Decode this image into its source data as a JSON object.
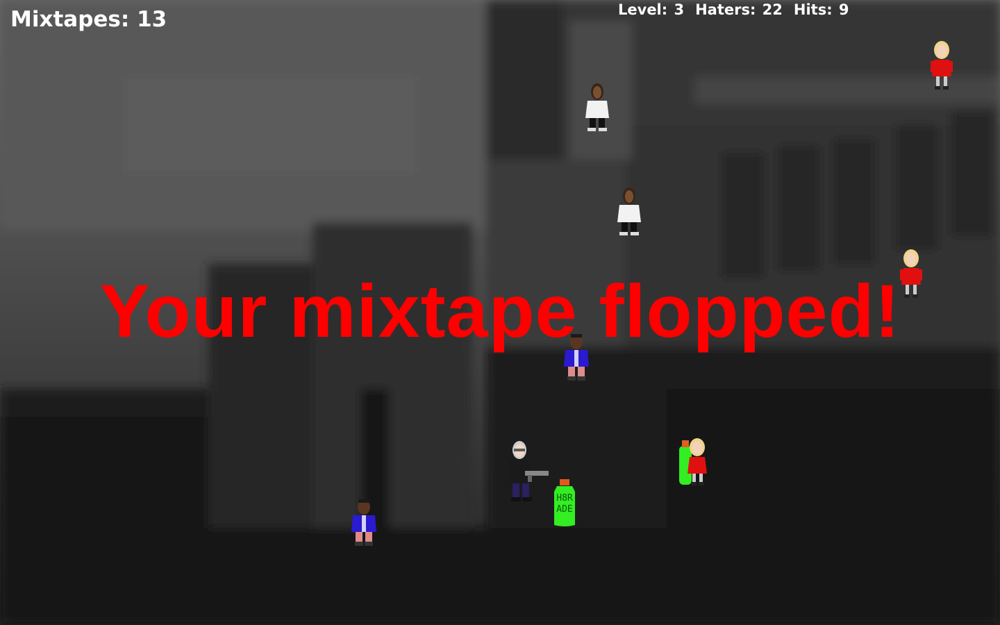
{
  "hud": {
    "mixtapes_label": "Mixtapes: 13",
    "level_label": "Level: 3",
    "haters_label": "Haters: 22",
    "hits_label": "Hits: 9"
  },
  "overlay": {
    "message": "Your mixtape flopped!",
    "color": "#ff0000"
  },
  "bottle": {
    "label_line1": "H8R",
    "label_line2": "ADE"
  },
  "sprites": [
    {
      "kind": "blonde-red-dress-hater-icon"
    },
    {
      "kind": "white-tee-hater-icon"
    },
    {
      "kind": "white-tee-hater-icon"
    },
    {
      "kind": "blonde-red-dress-hater-icon"
    },
    {
      "kind": "purple-jacket-hater-icon"
    },
    {
      "kind": "purple-jacket-hater-icon"
    },
    {
      "kind": "blonde-red-dress-hater-icon"
    },
    {
      "kind": "player-with-gun-icon"
    },
    {
      "kind": "haterade-bottle-icon"
    }
  ]
}
